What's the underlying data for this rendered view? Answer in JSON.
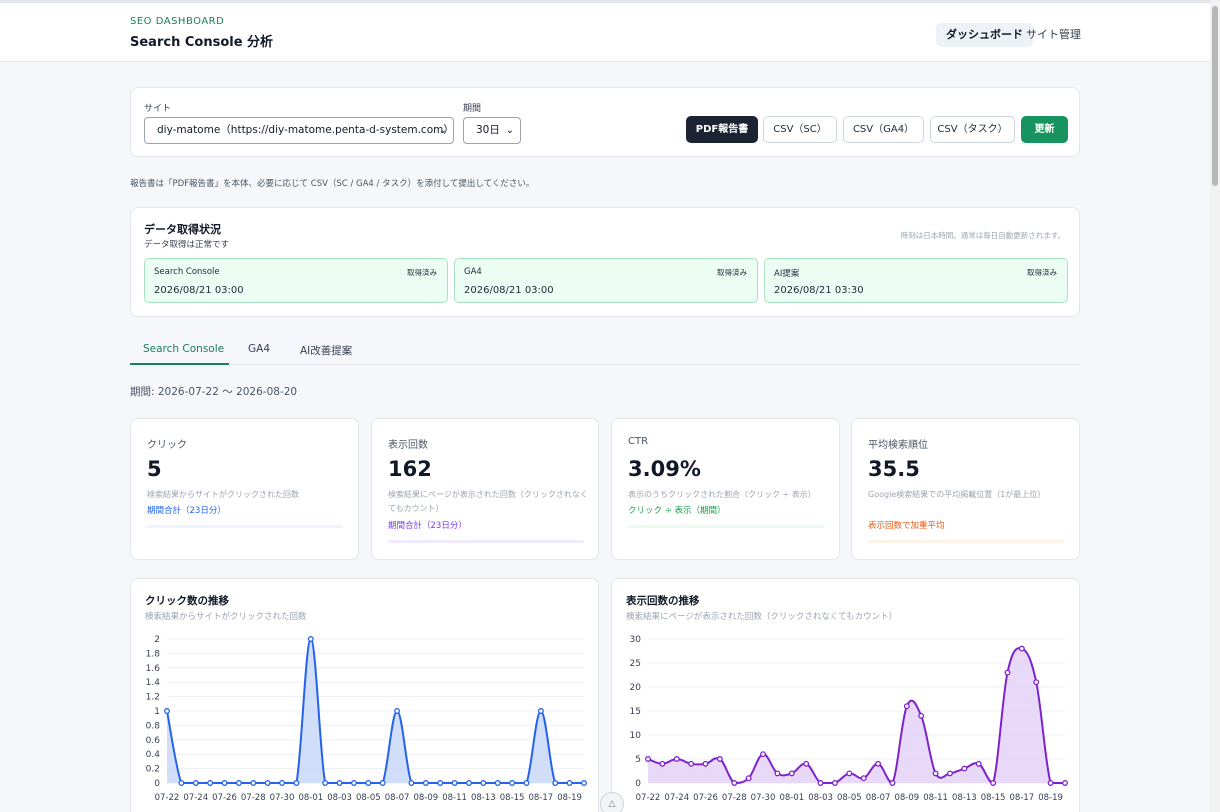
{
  "header": {
    "brand_small": "SEO DASHBOARD",
    "title": "Search Console 分析",
    "nav": [
      "ダッシュボード",
      "サイト管理"
    ]
  },
  "filters": {
    "site_label": "サイト",
    "site_value": "diy-matome（https://diy-matome.penta-d-system.com）",
    "period_label": "期間",
    "period_value": "30日",
    "buttons": {
      "pdf": "PDF報告書",
      "csv_sc": "CSV（SC）",
      "csv_ga4": "CSV（GA4）",
      "csv_task": "CSV（タスク）",
      "refresh": "更新"
    }
  },
  "report_note": "報告書は「PDF報告書」を本体、必要に応じて CSV（SC / GA4 / タスク）を添付して提出してください。",
  "data_status": {
    "title": "データ取得状況",
    "subtitle": "データ取得は正常です",
    "note": "時刻は日本時間。通常は毎日自動更新されます。",
    "sources": [
      {
        "name": "Search Console",
        "badge": "取得済み",
        "time": "2026/08/21 03:00"
      },
      {
        "name": "GA4",
        "badge": "取得済み",
        "time": "2026/08/21 03:00"
      },
      {
        "name": "AI提案",
        "badge": "取得済み",
        "time": "2026/08/21 03:30"
      }
    ]
  },
  "tabs": [
    "Search Console",
    "GA4",
    "AI改善提案"
  ],
  "period_text": "期間: 2026-07-22 〜 2026-08-20",
  "kpis": [
    {
      "title": "クリック",
      "value": "5",
      "desc": "検索結果からサイトがクリックされた回数",
      "foot": "期間合計（23日分）",
      "foot_color": "#2563eb",
      "bar_color": "#eef3fd"
    },
    {
      "title": "表示回数",
      "value": "162",
      "desc": "検索結果にページが表示された回数（クリックされなくてもカウント）",
      "foot": "期間合計（23日分）",
      "foot_color": "#7c3aed",
      "bar_color": "#f1ecfd"
    },
    {
      "title": "CTR",
      "value": "3.09%",
      "desc": "表示のうちクリックされた割合（クリック ÷ 表示）",
      "foot": "クリック ÷ 表示（期間）",
      "foot_color": "#16a34a",
      "bar_color": "#ecfbf1"
    },
    {
      "title": "平均検索順位",
      "value": "35.5",
      "desc": "Google検索結果での平均掲載位置（1が最上位）",
      "foot": "表示回数で加重平均",
      "foot_color": "#ea580c",
      "bar_color": "#fdf3e6"
    }
  ],
  "chart_data": [
    {
      "type": "area",
      "title": "クリック数の推移",
      "subtitle": "検索結果からサイトがクリックされた回数",
      "color": "#2563eb",
      "fill": "#c9d8f8",
      "yticks": [
        0,
        0.2,
        0.4,
        0.6,
        0.8,
        1,
        1.2,
        1.4,
        1.6,
        1.8,
        2
      ],
      "ylim": [
        0,
        2
      ],
      "x": [
        "07-22",
        "07-23",
        "07-24",
        "07-25",
        "07-26",
        "07-27",
        "07-28",
        "07-29",
        "07-30",
        "07-31",
        "08-01",
        "08-02",
        "08-03",
        "08-04",
        "08-05",
        "08-06",
        "08-07",
        "08-08",
        "08-09",
        "08-10",
        "08-11",
        "08-12",
        "08-13",
        "08-14",
        "08-15",
        "08-16",
        "08-17",
        "08-18",
        "08-19",
        "08-20"
      ],
      "xticks": [
        "07-22",
        "07-24",
        "07-26",
        "07-28",
        "07-30",
        "08-01",
        "08-03",
        "08-05",
        "08-07",
        "08-09",
        "08-11",
        "08-13",
        "08-15",
        "08-17",
        "08-19"
      ],
      "values": [
        1,
        0,
        0,
        0,
        0,
        0,
        0,
        0,
        0,
        0,
        2,
        0,
        0,
        0,
        0,
        0,
        1,
        0,
        0,
        0,
        0,
        0,
        0,
        0,
        0,
        0,
        1,
        0,
        0,
        0
      ]
    },
    {
      "type": "area",
      "title": "表示回数の推移",
      "subtitle": "検索結果にページが表示された回数（クリックされなくてもカウント）",
      "color": "#7e22ce",
      "fill": "#e4d2f8",
      "yticks": [
        0,
        5,
        10,
        15,
        20,
        25,
        30
      ],
      "ylim": [
        0,
        30
      ],
      "x": [
        "07-22",
        "07-23",
        "07-24",
        "07-25",
        "07-26",
        "07-27",
        "07-28",
        "07-29",
        "07-30",
        "07-31",
        "08-01",
        "08-02",
        "08-03",
        "08-04",
        "08-05",
        "08-06",
        "08-07",
        "08-08",
        "08-09",
        "08-10",
        "08-11",
        "08-12",
        "08-13",
        "08-14",
        "08-15",
        "08-16",
        "08-17",
        "08-18",
        "08-19",
        "08-20"
      ],
      "xticks": [
        "07-22",
        "07-24",
        "07-26",
        "07-28",
        "07-30",
        "08-01",
        "08-03",
        "08-05",
        "08-07",
        "08-09",
        "08-11",
        "08-13",
        "08-15",
        "08-17",
        "08-19"
      ],
      "values": [
        5,
        4,
        5,
        4,
        4,
        5,
        0,
        1,
        6,
        2,
        2,
        4,
        0,
        0,
        2,
        1,
        4,
        0,
        16,
        14,
        2,
        2,
        3,
        4,
        0,
        23,
        28,
        21,
        0,
        0
      ]
    }
  ]
}
